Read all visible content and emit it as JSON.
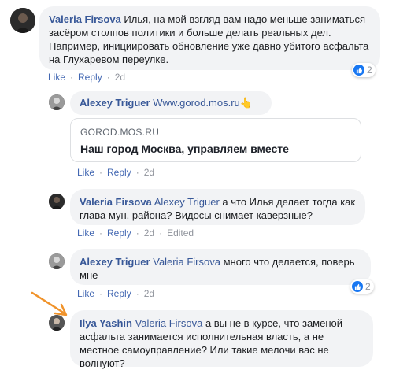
{
  "comments": [
    {
      "author": "Valeria Firsova",
      "text": "Илья, на мой взгляд вам надо меньше заниматься засёром столпов политики и больше делать реальных дел. Например, инициировать обновление уже давно убитого асфальта на Глухаревом переулке.",
      "actions": {
        "like": "Like",
        "reply": "Reply",
        "time": "2d"
      },
      "reaction_count": "2"
    },
    {
      "author": "Alexey Triguer",
      "text": "Www.gorod.mos.ru",
      "emoji": "👆",
      "link_preview": {
        "domain": "GOROD.MOS.RU",
        "title": "Наш город Москва, управляем вместе"
      },
      "actions": {
        "like": "Like",
        "reply": "Reply",
        "time": "2d"
      }
    },
    {
      "author": "Valeria Firsova",
      "mention": "Alexey Triguer",
      "text": "а что Илья делает тогда как глава мун. района? Видосы снимает каверзные?",
      "actions": {
        "like": "Like",
        "reply": "Reply",
        "time": "2d",
        "edited": "Edited"
      }
    },
    {
      "author": "Alexey Triguer",
      "mention": "Valeria Firsova",
      "text": "много что делается, поверь мне",
      "actions": {
        "like": "Like",
        "reply": "Reply",
        "time": "2d"
      },
      "reaction_count": "2"
    },
    {
      "author": "Ilya Yashin",
      "mention": "Valeria Firsova",
      "text": "а вы не в курсе, что заменой асфальта занимается исполнительная власть, а не местное самоуправление? Или такие мелочи вас не волнуют?"
    }
  ],
  "colors": {
    "link_blue": "#385898",
    "action_blue": "#4267b2",
    "bubble_bg": "#f2f3f5",
    "arrow_orange": "#f0932b",
    "like_blue": "#1877f2"
  }
}
